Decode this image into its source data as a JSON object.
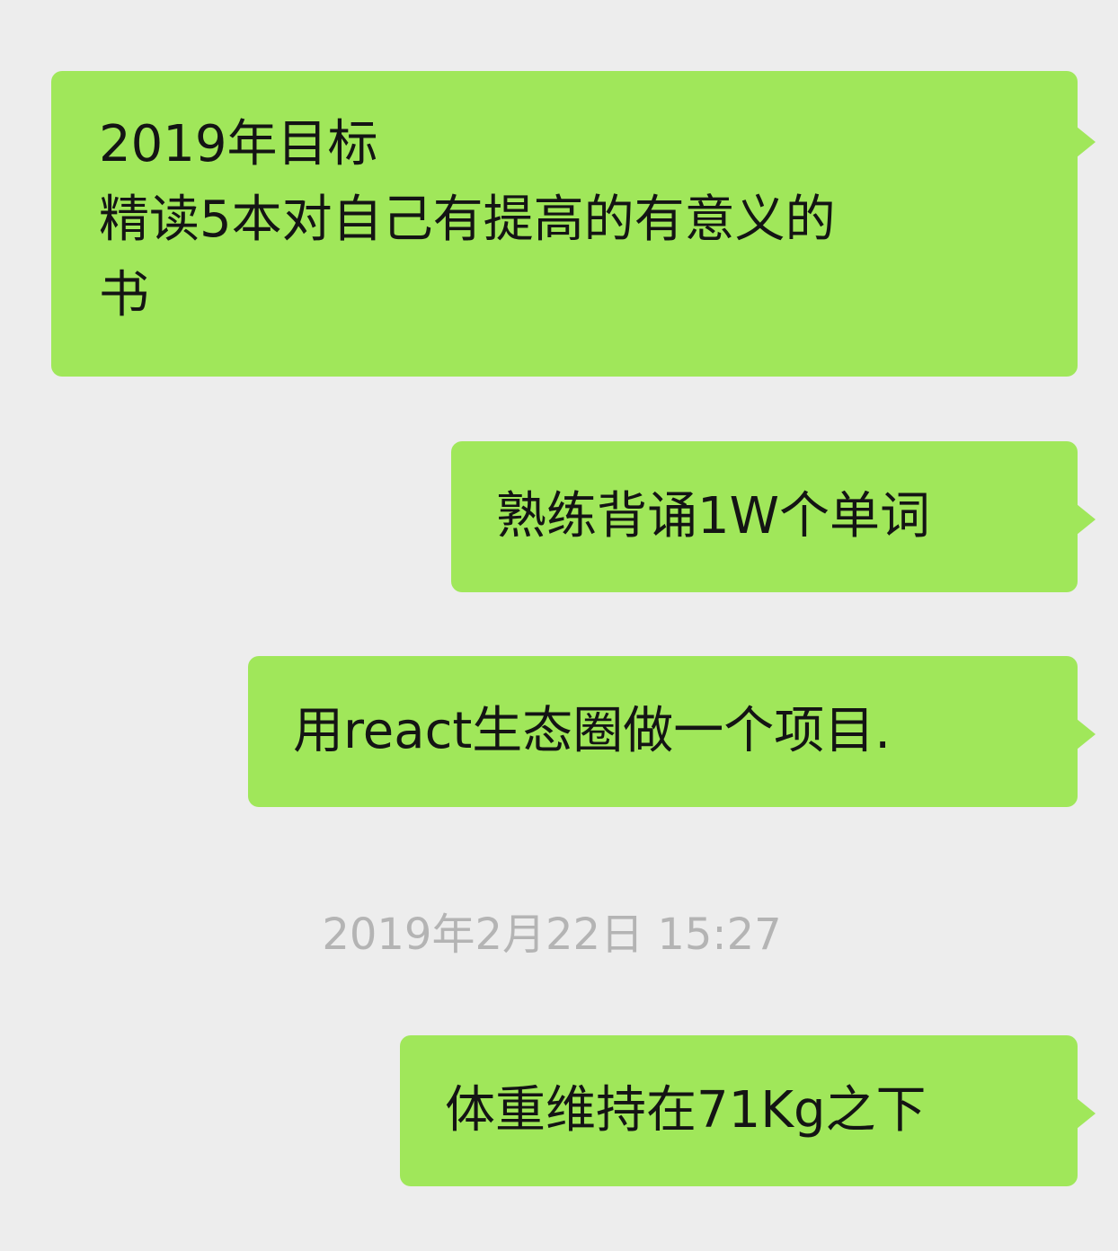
{
  "messages": [
    {
      "lines": [
        "2019年目标",
        "精读5本对自己有提高的有意义的",
        "书"
      ]
    },
    {
      "text": "熟练背诵1W个单词"
    },
    {
      "text": "用react生态圈做一个项目."
    },
    {
      "text": "体重维持在71Kg之下"
    }
  ],
  "timestamp": "2019年2月22日 15:27",
  "colors": {
    "background": "#ededed",
    "bubble": "#a0e75a",
    "text": "#141414",
    "timestamp": "#b4b4b4"
  }
}
